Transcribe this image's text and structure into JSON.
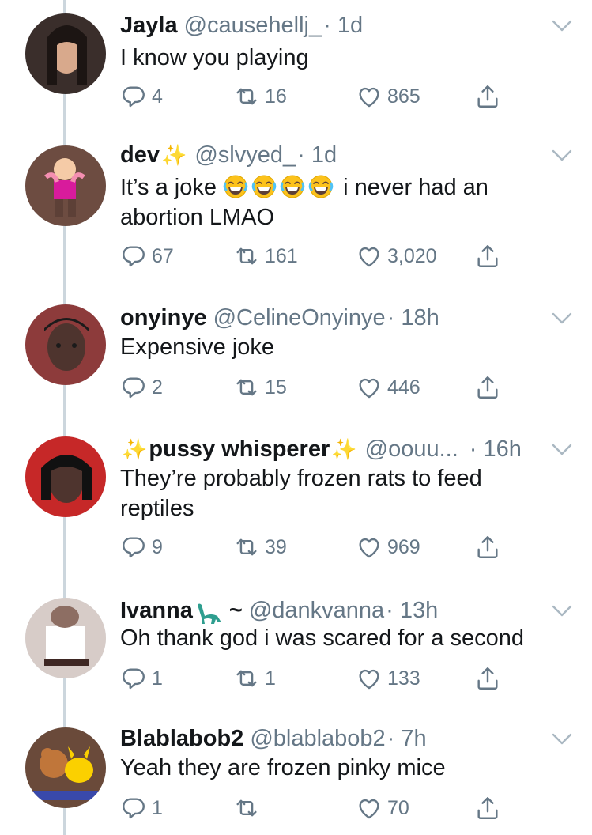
{
  "tweets": [
    {
      "name": "Jayla",
      "handle": "@causehellj_",
      "time": "· 1d",
      "text": "I know you playing",
      "replies": "4",
      "retweets": "16",
      "likes": "865"
    },
    {
      "name": "dev",
      "handle": "@slvyed_",
      "time": "· 1d",
      "text_before": "It’s a joke",
      "text_after": "i never had an",
      "text_line2": "abortion LMAO",
      "replies": "67",
      "retweets": "161",
      "likes": "3,020"
    },
    {
      "name": "onyinye",
      "handle": "@CelineOnyinye",
      "time": "· 18h",
      "text": "Expensive joke",
      "replies": "2",
      "retweets": "15",
      "likes": "446"
    },
    {
      "name": "pussy whisperer",
      "handle": "@oouu...",
      "time": "· 16h",
      "text_line1": "They’re probably frozen rats to feed",
      "text_line2": "reptiles",
      "replies": "9",
      "retweets": "39",
      "likes": "969"
    },
    {
      "name": "Ivanna",
      "handle": "@dankvanna",
      "time": "· 13h",
      "text": "Oh thank god i was scared for a second",
      "replies": "1",
      "retweets": "1",
      "likes": "133"
    },
    {
      "name": "Blablabob2",
      "handle": "@blablabob2",
      "time": "· 7h",
      "text": "Yeah they are frozen pinky mice",
      "replies": "1",
      "retweets": "",
      "likes": "70"
    }
  ],
  "colors": {
    "secondary_text": "#657786",
    "thread_line": "#ccd6dd",
    "sparkle": "#f5c518"
  }
}
